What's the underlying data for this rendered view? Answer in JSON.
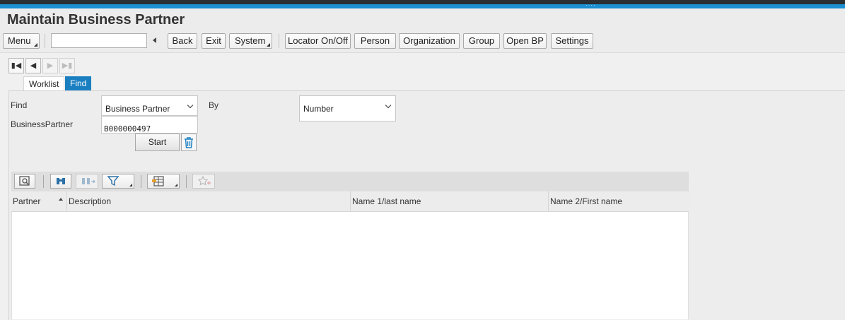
{
  "app": {
    "title": "Maintain Business Partner"
  },
  "toolbar": {
    "menu_label": "Menu",
    "command_value": "",
    "back_label": "Back",
    "exit_label": "Exit",
    "system_label": "System",
    "locator_label": "Locator On/Off",
    "person_label": "Person",
    "organization_label": "Organization",
    "group_label": "Group",
    "open_bp_label": "Open BP",
    "settings_label": "Settings"
  },
  "tabs": {
    "worklist": "Worklist",
    "find": "Find",
    "active": "Find"
  },
  "find_form": {
    "find_label": "Find",
    "find_value": "Business Partner",
    "by_label": "By",
    "by_value": "Number",
    "bp_label": "BusinessPartner",
    "bp_value": "B000000497",
    "start_label": "Start"
  },
  "grid": {
    "columns": [
      "Partner",
      "Description",
      "Name 1/last name",
      "Name 2/First name"
    ],
    "rows": []
  },
  "colors": {
    "accent": "#1a8fd1",
    "tab_active": "#1a7fc1"
  }
}
